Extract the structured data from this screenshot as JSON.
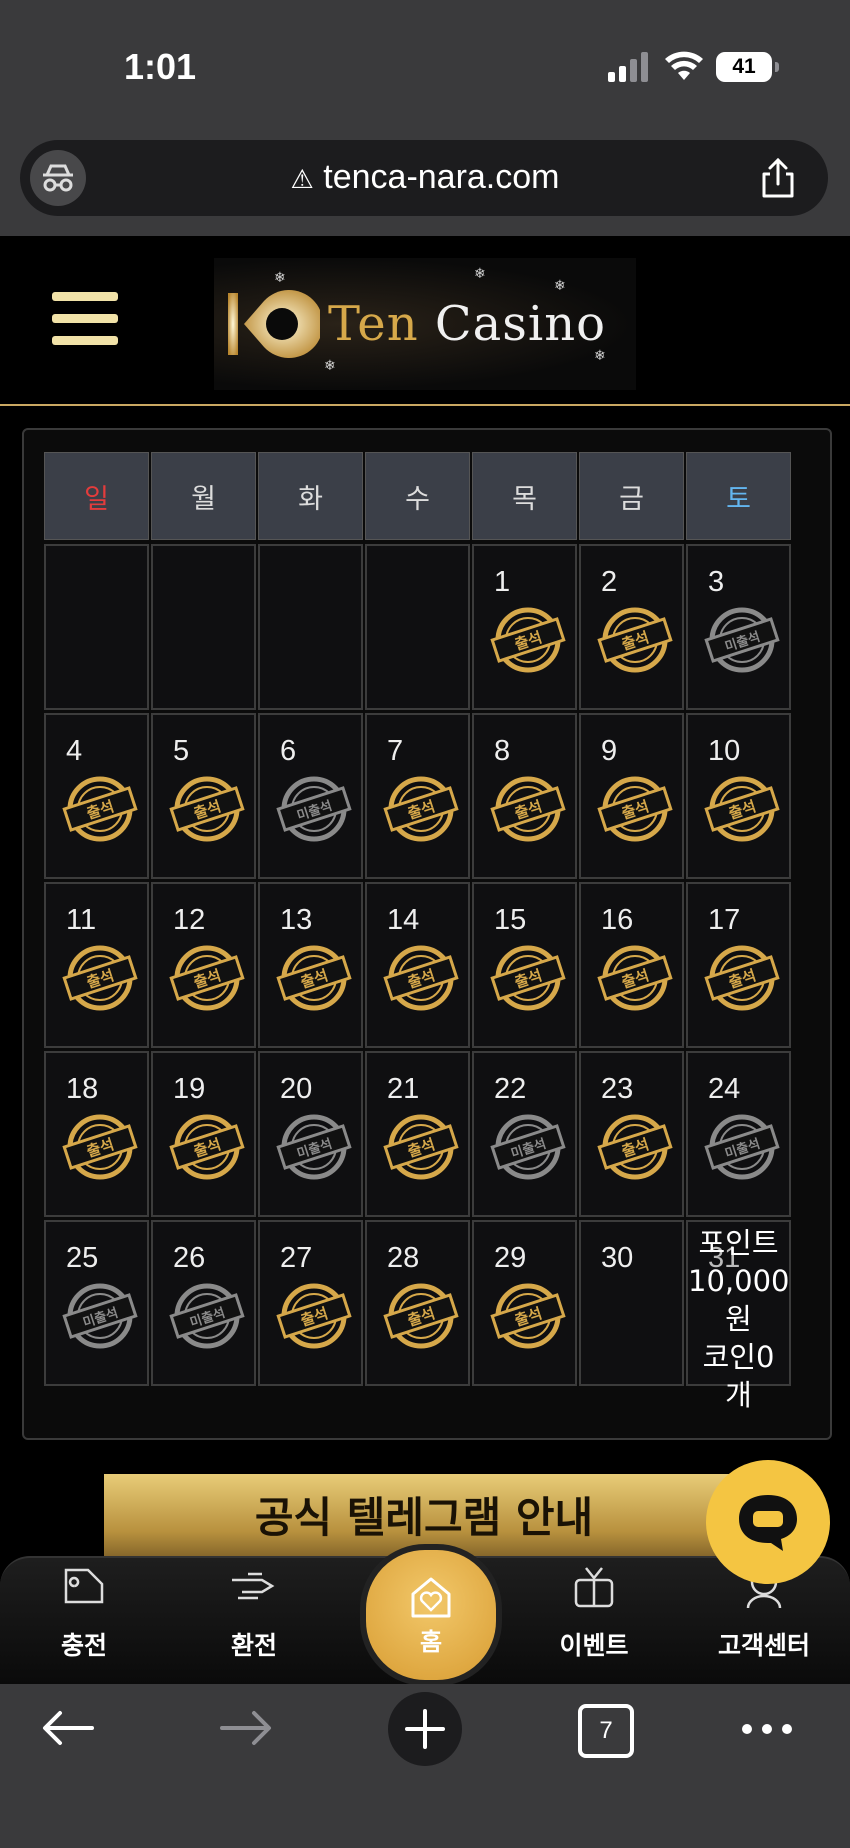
{
  "status_bar": {
    "time": "1:01",
    "battery": "41"
  },
  "browser": {
    "url": "tenca-nara.com",
    "tab_count": "7"
  },
  "site": {
    "logo_text_1": "Ten",
    "logo_text_2": "Casino"
  },
  "calendar": {
    "weekdays": [
      "일",
      "월",
      "화",
      "수",
      "목",
      "금",
      "토"
    ],
    "weeks": [
      [
        {
          "day": "",
          "status": ""
        },
        {
          "day": "",
          "status": ""
        },
        {
          "day": "",
          "status": ""
        },
        {
          "day": "",
          "status": ""
        },
        {
          "day": "1",
          "status": "출석"
        },
        {
          "day": "2",
          "status": "출석"
        },
        {
          "day": "3",
          "status": "미출석"
        }
      ],
      [
        {
          "day": "4",
          "status": "출석"
        },
        {
          "day": "5",
          "status": "출석"
        },
        {
          "day": "6",
          "status": "미출석"
        },
        {
          "day": "7",
          "status": "출석"
        },
        {
          "day": "8",
          "status": "출석"
        },
        {
          "day": "9",
          "status": "출석"
        },
        {
          "day": "10",
          "status": "출석"
        }
      ],
      [
        {
          "day": "11",
          "status": "출석"
        },
        {
          "day": "12",
          "status": "출석"
        },
        {
          "day": "13",
          "status": "출석"
        },
        {
          "day": "14",
          "status": "출석"
        },
        {
          "day": "15",
          "status": "출석"
        },
        {
          "day": "16",
          "status": "출석"
        },
        {
          "day": "17",
          "status": "출석"
        }
      ],
      [
        {
          "day": "18",
          "status": "출석"
        },
        {
          "day": "19",
          "status": "출석"
        },
        {
          "day": "20",
          "status": "미출석"
        },
        {
          "day": "21",
          "status": "출석"
        },
        {
          "day": "22",
          "status": "미출석"
        },
        {
          "day": "23",
          "status": "출석"
        },
        {
          "day": "24",
          "status": "미출석"
        }
      ],
      [
        {
          "day": "25",
          "status": "미출석"
        },
        {
          "day": "26",
          "status": "미출석"
        },
        {
          "day": "27",
          "status": "출석"
        },
        {
          "day": "28",
          "status": "출석"
        },
        {
          "day": "29",
          "status": "출석"
        },
        {
          "day": "30",
          "status": ""
        },
        {
          "day": "31",
          "status": ""
        }
      ]
    ],
    "last_cell_note": [
      "포인트",
      "10,000",
      "원",
      "코인0",
      "개"
    ]
  },
  "banner": {
    "text": "공식 텔레그램 안내"
  },
  "bottom_nav": {
    "charge": "충전",
    "exchange": "환전",
    "home": "홈",
    "event": "이벤트",
    "support": "고객센터"
  },
  "colors": {
    "gold": "#d6a84a",
    "absent": "#8a8a8a",
    "sunday": "#e33c3c",
    "saturday": "#63b6f0"
  }
}
